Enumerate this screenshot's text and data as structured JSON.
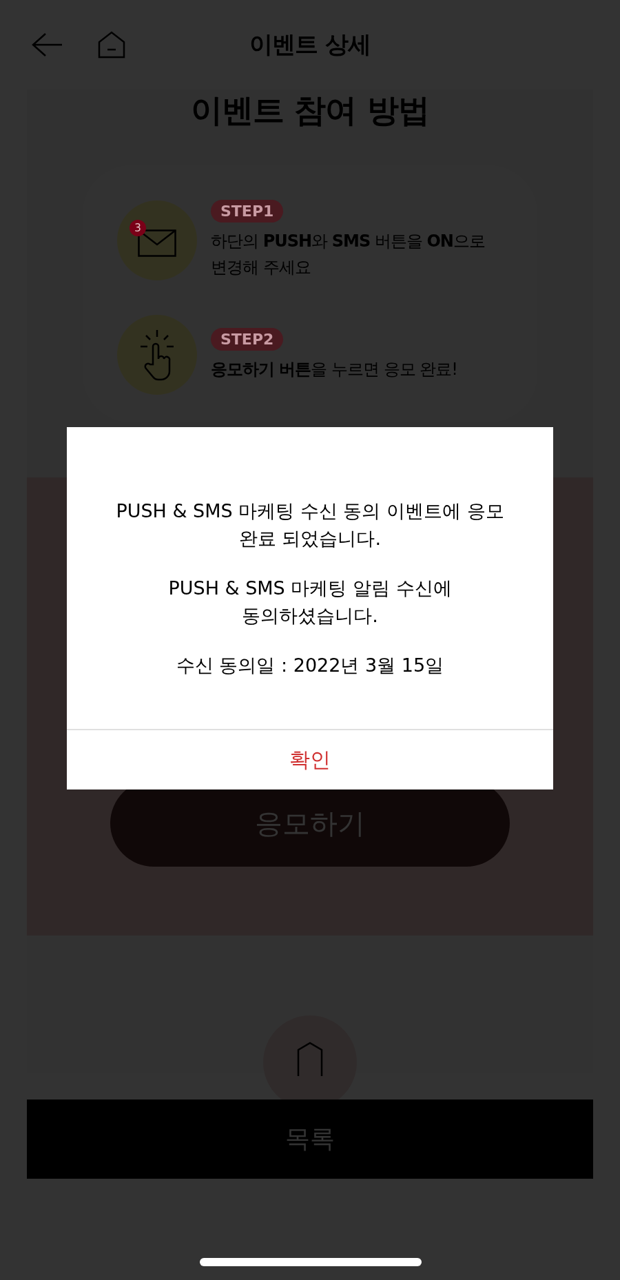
{
  "header": {
    "title": "이벤트 상세"
  },
  "section": {
    "heading": "이벤트 참여 방법",
    "steps": [
      {
        "badge": "STEP1",
        "kind": "mail",
        "count": "3",
        "text": "하단의 **PUSH**와 **SMS** 버튼을 **ON**으로 변경해 주세요"
      },
      {
        "badge": "STEP2",
        "kind": "tap",
        "text": "**응모하기 버튼**을 누르면 응모 완료!"
      }
    ],
    "apply_button": "응모하기"
  },
  "list_button": "목록",
  "dialog": {
    "paragraphs": [
      "PUSH & SMS 마케팅 수신 동의 이벤트에 응모 완료 되었습니다.",
      "PUSH & SMS 마케팅 알림 수신에 동의하셨습니다.",
      "수신 동의일 : 2022년 3월 15일"
    ],
    "confirm": "확인"
  }
}
